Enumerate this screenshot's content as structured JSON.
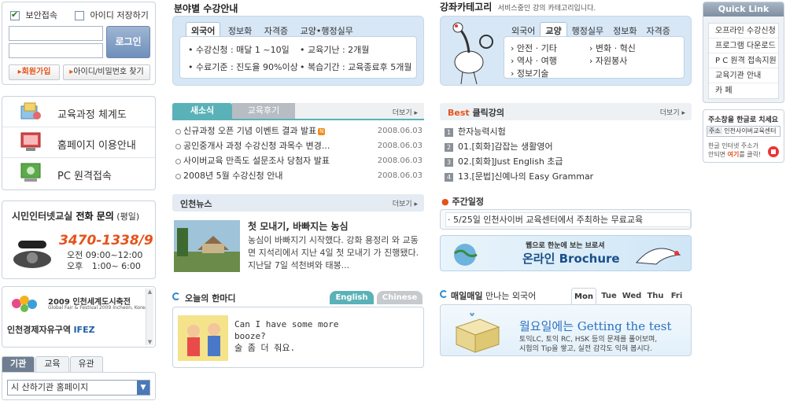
{
  "login": {
    "secure_label": "보안접속",
    "save_id_label": "아이디 저장하기",
    "login_button": "로그인",
    "join_button": "회원가입",
    "find_button": "아이디/비밀번호 찾기"
  },
  "menu": {
    "items": [
      {
        "label": "교육과정 체계도"
      },
      {
        "label": "홈페이지 이용안내"
      },
      {
        "label": "PC 원격접속"
      }
    ]
  },
  "phone": {
    "title_a": "시민인터넷교실 ",
    "title_b": "전화 문의",
    "title_c": " (평일)",
    "number": "3470-1338/9",
    "am_label": "오전",
    "am_hours": "09:00~12:00",
    "pm_label": "오후",
    "pm_hours": "1:00~ 6:00"
  },
  "banner": {
    "line1": "2009 인천세계도시축전",
    "line1_sub": "Global Fair & Festival 2009 Incheon, Korea",
    "line2": "인천경제자유구역",
    "line2_b": "IFEZ"
  },
  "site_tabs": {
    "tabs": [
      "기관",
      "교육",
      "유관"
    ],
    "select_value": "시 산하기관 홈페이지"
  },
  "field_guide": {
    "title": "분야별 수강안내",
    "tabs": [
      "외국어",
      "정보화",
      "자격증",
      "교양•행정실무"
    ],
    "items": [
      "수강신청 : 매달  1 ~10일",
      "교육기난 : 2개월",
      "수료기준 : 진도율 90%이상",
      "복습기간 : 교육종료후 5개월"
    ]
  },
  "categories": {
    "title": "강좌카테고리",
    "subtitle": "서비스중인 강의 카테고리입니다.",
    "tabs": [
      "외국어",
      "교양",
      "행정실무",
      "정보화",
      "자격증"
    ],
    "items": [
      "안전 · 기타",
      "변화 · 혁신",
      "역사 · 여행",
      "자원봉사",
      "정보기술"
    ]
  },
  "quick_link": {
    "title": "Quick Link",
    "items": [
      "오프라인 수강신청",
      "프로그램 다운로드",
      "P C 원격 접속지원",
      "교육기관 안내",
      "카     페"
    ]
  },
  "hangul_search": {
    "title": "주소창을 한글로 치세요",
    "prefix": "주소",
    "value": "인천사이버교육센터",
    "desc1": "한글 인터넷 주소가",
    "desc2a": "안되면 ",
    "desc2b": "여기",
    "desc2c": "를 클릭!"
  },
  "news": {
    "tab_on": "새소식",
    "tab_off": "교육후기",
    "more": "더보기",
    "rows": [
      {
        "title": "신규과정 오픈 기념 이벤트 결과 발표",
        "new": "N",
        "date": "2008.06.03"
      },
      {
        "title": "공인중개사 과정 수강신청 과목수 변경...",
        "date": "2008.06.03"
      },
      {
        "title": "사이버교육 만족도 설문조사 당첨자 발표",
        "date": "2008.06.03"
      },
      {
        "title": "2008년 5월 수강신청 안내",
        "date": "2008.06.03"
      }
    ]
  },
  "best": {
    "title_a": "Best",
    "title_b": " 클릭강의",
    "more": "더보기",
    "rows": [
      {
        "rank": "1",
        "title": "한자능력시험"
      },
      {
        "rank": "2",
        "title": "01.[회화]감잡는 생활영어"
      },
      {
        "rank": "3",
        "title": "02.[회화]Just English 초급"
      },
      {
        "rank": "4",
        "title": "13.[문법]신예나의 Easy Grammar"
      }
    ]
  },
  "incheon_news": {
    "title": "인천뉴스",
    "more": "더보기",
    "headline": "첫 모내기, 바빠지는 농심",
    "body": "농심이 바빠지기 시작했다. 강화 용정리 와 교동면 지석리에서 지난 4일 첫 모내기 가 진행됐다. 지난달 7일 석천벼와 태봉..."
  },
  "schedule": {
    "title": "주간일정",
    "item": "· 5/25일 인천사이버 교육센터에서 주최하는 무료교육",
    "brochure_small": "웹으로 한눈에 보는 브로셔",
    "brochure_big": "온라인 Brochure"
  },
  "phrase": {
    "title": "오늘의 한마디",
    "tab_on": "English",
    "tab_off": "Chinese",
    "en_line1": "Can I have some more",
    "en_line2": "booze?",
    "ko_line": "술 좀 더 줘요."
  },
  "daily": {
    "title_a": "매일매일",
    "title_b": " 만나는 외국어",
    "days": [
      "Mon",
      "Tue",
      "Wed",
      "Thu",
      "Fri"
    ],
    "headline": "월요일에는 Getting the test",
    "body1": "토익LC, 토익 RC, HSK 등의 문제를 풀어보며,",
    "body2": "시험의 Tip을 쌓고, 실전 감각도 익혀 봅시다."
  },
  "colors": {
    "accent_orange": "#e5531a",
    "panel_blue": "#d7e7f5",
    "tab_teal": "#5ab2b8"
  }
}
